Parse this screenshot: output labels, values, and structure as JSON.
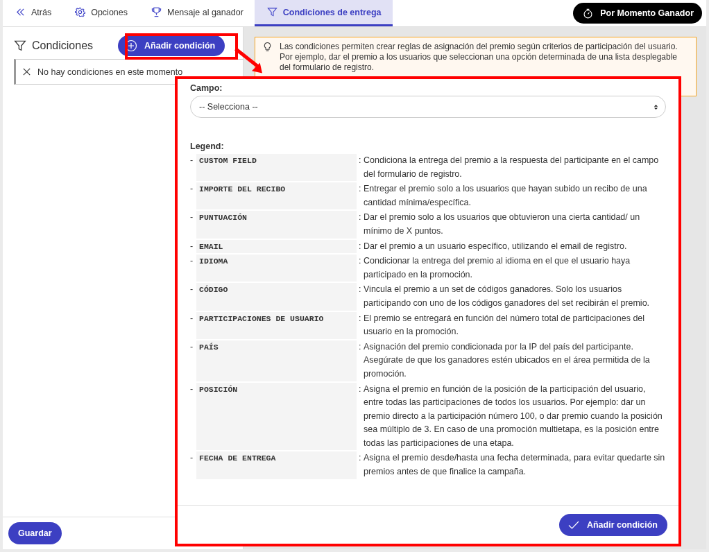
{
  "tabs": [
    {
      "label": "Atrás",
      "kind": "back",
      "selected": false
    },
    {
      "label": "Opciones",
      "kind": "settings",
      "selected": false
    },
    {
      "label": "Mensaje al ganador",
      "kind": "prize",
      "selected": false
    },
    {
      "label": "Condiciones de entrega",
      "kind": "filter",
      "selected": true
    }
  ],
  "mode_button": "Por Momento Ganador",
  "sidebar": {
    "title": "Condiciones",
    "add_button": "Añadir condición",
    "empty_message": "No hay condiciones en este momento",
    "save_button": "Guardar"
  },
  "info": "Las condiciones permiten crear reglas de asignación del premio según criterios de participación del usuario. Por ejemplo, dar el premio a los usuarios que seleccionan una opción determinada de una lista desplegable del formulario de registro.",
  "dialog": {
    "field_label": "Campo:",
    "select_placeholder": "-- Selecciona --",
    "legend_title": "Legend:",
    "legend": [
      {
        "bullet": "-",
        "code": "CUSTOM FIELD",
        "separator": ":",
        "description": "Condiciona la entrega del premio a la respuesta del participante en el campo del formulario de registro."
      },
      {
        "bullet": "-",
        "code": "IMPORTE DEL RECIBO",
        "separator": ":",
        "description": "Entregar el premio solo a los usuarios que hayan subido un recibo de una cantidad mínima/específica."
      },
      {
        "bullet": "-",
        "code": "PUNTUACIÓN",
        "separator": ":",
        "description": "Dar el premio solo a los usuarios que obtuvieron una cierta cantidad/ un mínimo de X puntos."
      },
      {
        "bullet": "-",
        "code": "EMAIL",
        "separator": ":",
        "description": "Dar el premio a un usuario específico, utilizando el email de registro."
      },
      {
        "bullet": "-",
        "code": "IDIOMA",
        "separator": ":",
        "description": "Condicionar la entrega del premio al idioma en el que el usuario haya participado en la promoción."
      },
      {
        "bullet": "-",
        "code": "CÓDIGO",
        "separator": ":",
        "description": "Vincula el premio a un set de códigos ganadores. Solo los usuarios participando con uno de los códigos ganadores del set recibirán el premio."
      },
      {
        "bullet": "-",
        "code": "PARTICIPACIONES DE USUARIO",
        "separator": ":",
        "description": "El premio se entregará en función del número total de participaciones del usuario en la promoción."
      },
      {
        "bullet": "-",
        "code": "PAÍS",
        "separator": ":",
        "description": "Asignación del premio condicionada por la IP del país del participante. Asegúrate de que los ganadores estén ubicados en el área permitida de la promoción."
      },
      {
        "bullet": "-",
        "code": "POSICIÓN",
        "separator": ":",
        "description": "Asigna el premio en función de la posición de la participación del usuario, entre todas las participaciones de todos los usuarios. Por ejemplo: dar un premio directo a la participación número 100, o dar premio cuando la posición sea múltiplo de 3. En caso de una promoción multietapa, es la posición entre todas las participaciones de una etapa."
      },
      {
        "bullet": "-",
        "code": "FECHA DE ENTREGA",
        "separator": ":",
        "description": "Asigna el premio desde/hasta una fecha determinada, para evitar quedarte sin premios antes de que finalice la campaña."
      }
    ],
    "submit_button": "Añadir condición"
  }
}
